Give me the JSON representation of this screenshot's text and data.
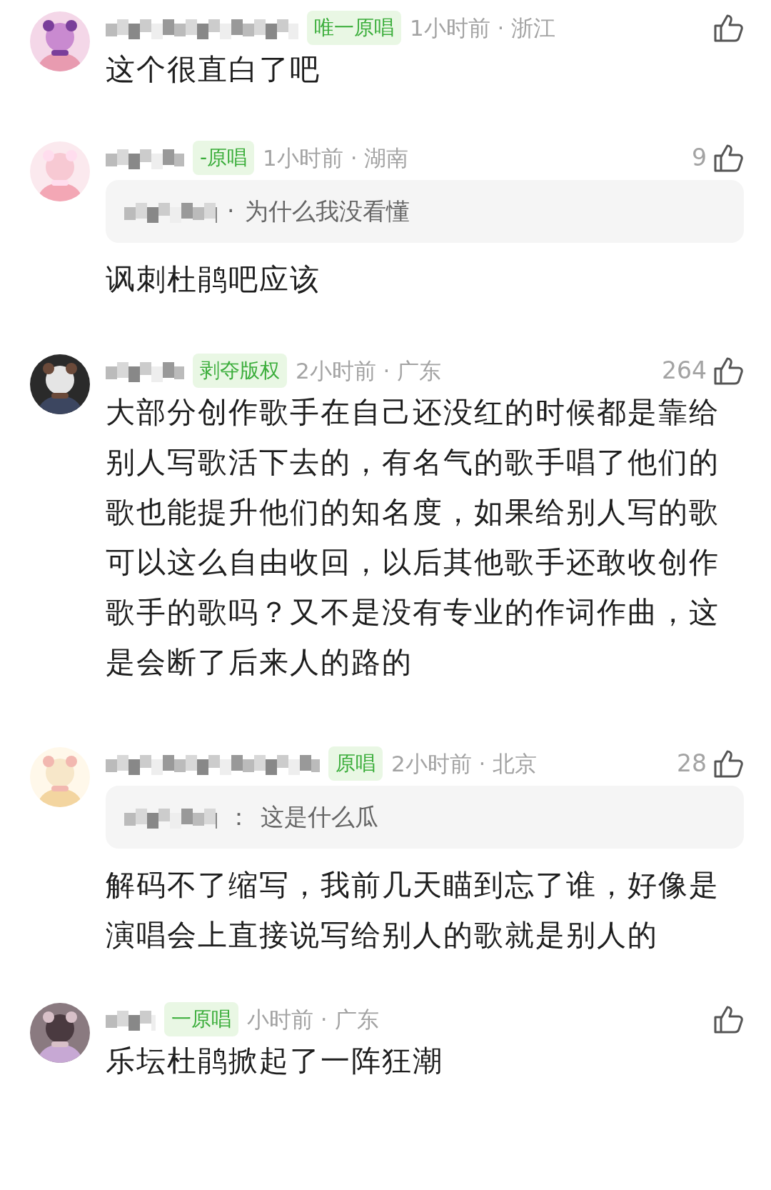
{
  "comments": [
    {
      "badge": "唯一原唱",
      "meta": "1小时前 · 浙江",
      "text": "这个很直白了吧"
    },
    {
      "badge": "-原唱",
      "meta": "1小时前 · 湖南",
      "likes": "9",
      "reply": {
        "separator": "·",
        "text": "为什么我没看懂"
      },
      "text": "讽刺杜鹃吧应该"
    },
    {
      "badge": "剥夺版权",
      "meta": "2小时前 · 广东",
      "likes": "264",
      "text": "大部分创作歌手在自己还没红的时候都是靠给别人写歌活下去的，有名气的歌手唱了他们的歌也能提升他们的知名度，如果给别人写的歌可以这么自由收回，以后其他歌手还敢收创作歌手的歌吗？又不是没有专业的作词作曲，这是会断了后来人的路的"
    },
    {
      "badge": "原唱",
      "meta": "2小时前 · 北京",
      "likes": "28",
      "reply": {
        "separator": "：",
        "text": "这是什么瓜"
      },
      "text": "解码不了缩写，我前几天瞄到忘了谁，好像是演唱会上直接说写给别人的歌就是别人的"
    },
    {
      "badge": "一原唱",
      "meta": "小时前 · 广东",
      "text": "乐坛杜鹃掀起了一阵狂潮"
    }
  ]
}
